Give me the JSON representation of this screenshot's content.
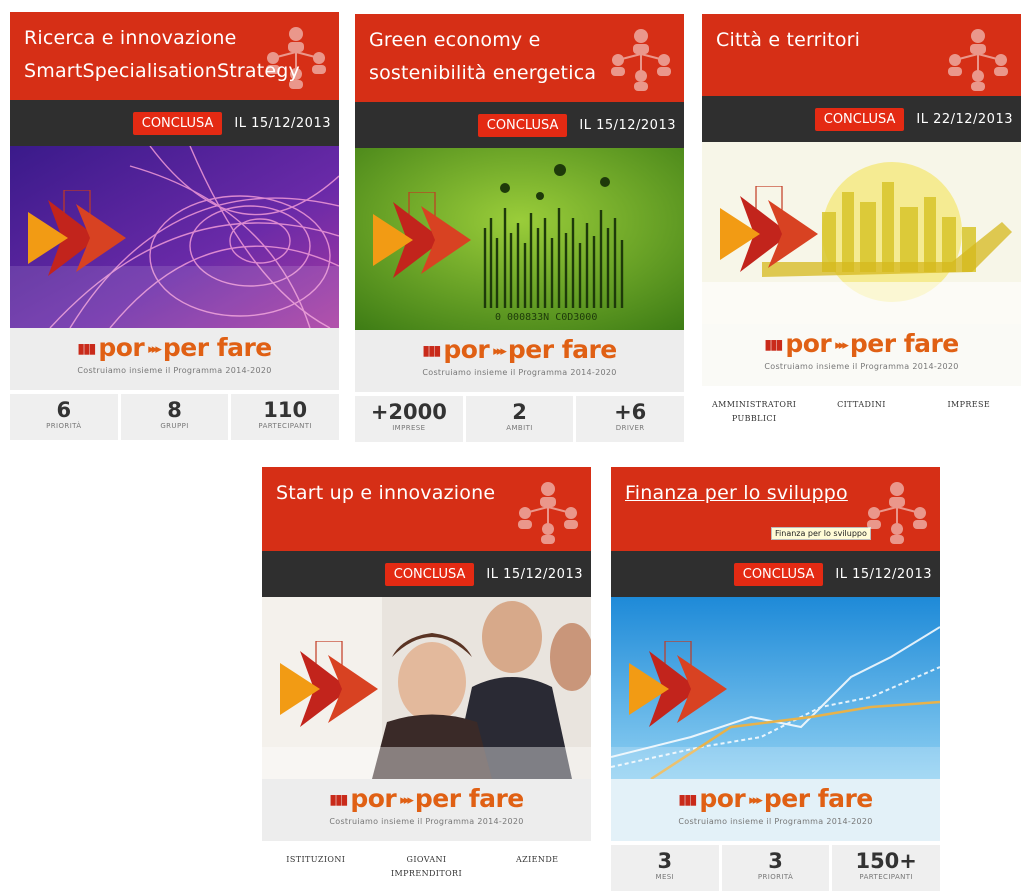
{
  "cards": [
    {
      "title_line1": "Ricerca e innovazione",
      "title_line2": "SmartSpecialisationStrategy",
      "status": "CONCLUSA",
      "date": "IL 15/12/2013",
      "stats": [
        {
          "value": "6",
          "label": "PRIORITÀ"
        },
        {
          "value": "8",
          "label": "GRUPPI"
        },
        {
          "value": "110",
          "label": "PARTECIPANTI"
        }
      ]
    },
    {
      "title_line1": "Green economy e",
      "title_line2": "sostenibilità energetica",
      "status": "CONCLUSA",
      "date": "IL 15/12/2013",
      "barcode_text": "0 000833N C0D3000",
      "stats": [
        {
          "value": "+2000",
          "label": "IMPRESE"
        },
        {
          "value": "2",
          "label": "AMBITI"
        },
        {
          "value": "+6",
          "label": "DRIVER"
        }
      ]
    },
    {
      "title_line1": "Città e territori",
      "status": "CONCLUSA",
      "date": "IL 22/12/2013",
      "stats": [
        {
          "label": "AMMINISTRATORI PUBBLICI"
        },
        {
          "label": "CITTADINI"
        },
        {
          "label": "IMPRESE"
        }
      ]
    },
    {
      "title_line1": "Start up e innovazione",
      "status": "CONCLUSA",
      "date": "IL 15/12/2013",
      "stats": [
        {
          "label": "ISTITUZIONI"
        },
        {
          "label": "GIOVANI IMPRENDITORI"
        },
        {
          "label": "AZIENDE"
        }
      ]
    },
    {
      "title_line1": "Finanza per lo sviluppo",
      "tooltip": "Finanza per lo sviluppo",
      "status": "CONCLUSA",
      "date": "IL 15/12/2013",
      "stats": [
        {
          "value": "3",
          "label": "MESI"
        },
        {
          "value": "3",
          "label": "PRIORITÀ"
        },
        {
          "value": "150+",
          "label": "PARTECIPANTI"
        }
      ]
    }
  ],
  "logo": {
    "part1": "por",
    "arrows": "▸▸▸",
    "part2": "per fare",
    "bars": "▮▮▮",
    "tagline": "Costruiamo insieme il Programma 2014-2020"
  },
  "colors": {
    "header_red": "#d62f16",
    "status_bar": "#2f2f2f",
    "badge_red": "#e42a13",
    "logo_orange": "#e06014"
  },
  "icons": {
    "header_decoration": "people-network-icon",
    "chevrons": "chevron-arrows-icon"
  }
}
